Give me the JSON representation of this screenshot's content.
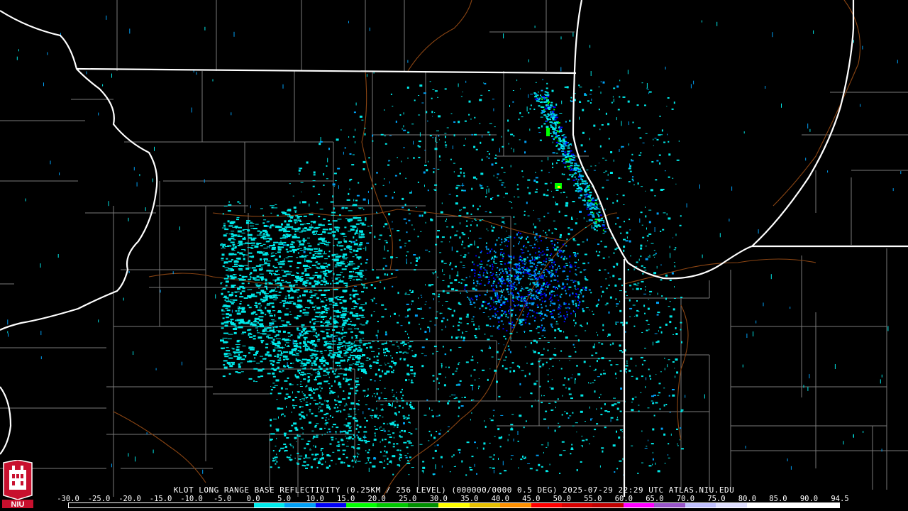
{
  "title": "KLOT LONG RANGE BASE REFLECTIVITY (0.25KM / 256 LEVEL) (000000/0000 0.5 DEG) 2025-07-29 22:29 UTC  ATLAS.NIU.EDU",
  "logo": {
    "text": "NIU",
    "color": "#c8102e"
  },
  "scale": {
    "labels": [
      "-30.0",
      "-25.0",
      "-20.0",
      "-15.0",
      "-10.0",
      "-5.0",
      "0.0",
      "5.0",
      "10.0",
      "15.0",
      "20.0",
      "25.0",
      "30.0",
      "35.0",
      "40.0",
      "45.0",
      "50.0",
      "55.0",
      "60.0",
      "65.0",
      "70.0",
      "75.0",
      "80.0",
      "85.0",
      "90.0",
      "94.5"
    ],
    "colors": [
      "#000000",
      "#000000",
      "#000000",
      "#000000",
      "#000000",
      "#000000",
      "#00ecec",
      "#01a0f6",
      "#0000f6",
      "#00ff00",
      "#00c800",
      "#009000",
      "#ffff00",
      "#e7c000",
      "#ff9000",
      "#ff0000",
      "#d60000",
      "#c00000",
      "#ff00ff",
      "#9955c9",
      "#c0c0ff",
      "#e0e0ff",
      "#ffffff",
      "#ffffff",
      "#ffffff"
    ]
  },
  "map": {
    "radar_site": "KLOT",
    "echo_colors": {
      "weak": "#00e8e8",
      "light": "#01a0f6",
      "moderate": "#0000f6",
      "strong": "#00ff00",
      "heavy": "#ffff00"
    },
    "boundary_colors": {
      "state": "#ffffff",
      "county": "#808080",
      "river": "#8b4513"
    }
  }
}
